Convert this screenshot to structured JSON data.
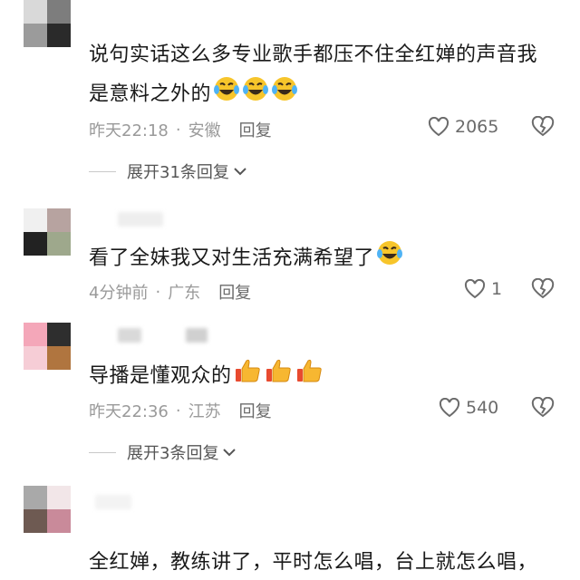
{
  "comments": [
    {
      "text_line1": "说句实话这么多专业歌手都压不住全红婵的声音我",
      "text_line2": "是意料之外的",
      "emoji": [
        "laugh-cry-emoji",
        "laugh-cry-emoji",
        "laugh-cry-emoji"
      ],
      "time": "昨天22:18",
      "location": "安徽",
      "reply_label": "回复",
      "likes": "2065",
      "expand_label": "展开31条回复"
    },
    {
      "text_line1": "看了全妹我又对生活充满希望了",
      "emoji": [
        "laugh-cry-emoji"
      ],
      "time": "4分钟前",
      "location": "广东",
      "reply_label": "回复",
      "likes": "1"
    },
    {
      "text_line1": "导播是懂观众的",
      "emoji": [
        "thumbs-up-emoji",
        "thumbs-up-emoji",
        "thumbs-up-emoji"
      ],
      "time": "昨天22:36",
      "location": "江苏",
      "reply_label": "回复",
      "likes": "540",
      "expand_label": "展开3条回复"
    },
    {
      "text_line1": "全红婵，教练讲了，平时怎么唱，台上就怎么唱，"
    }
  ],
  "separator": "·",
  "colors": {
    "text": "#1a1a1a",
    "meta": "#9a9a9a",
    "reply": "#6b6b6b"
  }
}
